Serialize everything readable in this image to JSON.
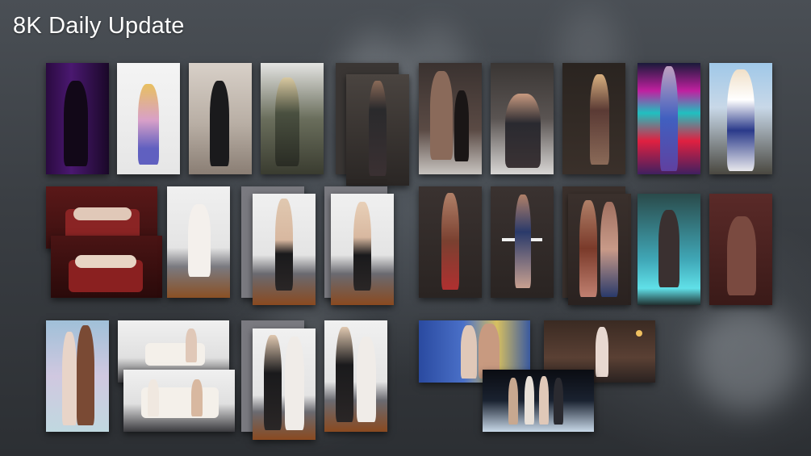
{
  "header": {
    "title": "8K Daily Update"
  },
  "gallery": {
    "item_count": 31
  }
}
